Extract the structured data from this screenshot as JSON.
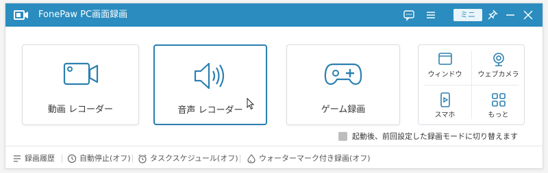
{
  "window": {
    "title": "FonePaw PC画面録画"
  },
  "titlebar": {
    "mini_label": "ミニ"
  },
  "cards": {
    "video": "動画 レコーダー",
    "audio": "音声 レコーダー",
    "game": "ゲーム録画"
  },
  "more_panel": {
    "window": "ウィンドウ",
    "webcam": "ウェブカメラ",
    "phone": "スマホ",
    "more": "もっと"
  },
  "option": {
    "checked": false,
    "label": "起動後、前回設定した録画モードに切り替えます"
  },
  "footer": {
    "history": "録画履歴",
    "auto_stop": "自動停止(オフ)",
    "schedule": "タスクスケジュール(オフ)",
    "watermark": "ウォーターマーク付き録画(オフ)"
  },
  "colors": {
    "accent": "#2b8cbf",
    "icon": "#2b7fb0"
  }
}
